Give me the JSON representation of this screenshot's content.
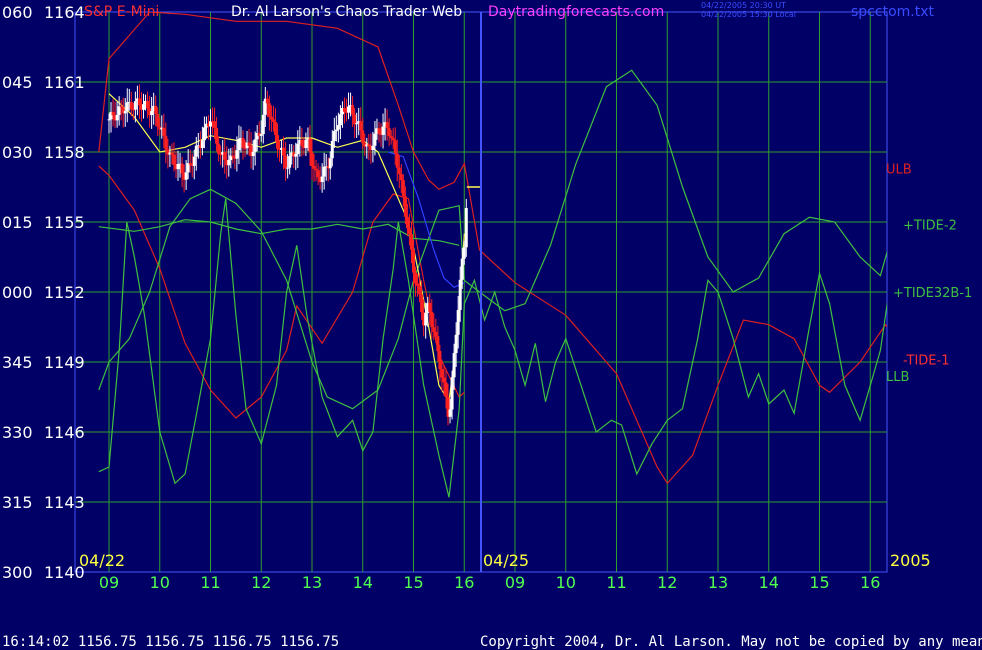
{
  "header": {
    "instrument": "S&P E-Mini",
    "title": "Dr. Al Larson's Chaos Trader Web",
    "site": "Daytradingforecasts.com",
    "time_ut": "04/22/2005 20:30 UT",
    "time_local": "04/22/2005 15:30 Local",
    "file": "spcctom.txt"
  },
  "footer": {
    "quote": "16:14:02  1156.75 1156.75 1156.75 1156.75",
    "copyright": "Copyright 2004, Dr. Al Larson. May not be copied by any means."
  },
  "colors": {
    "background": "#000066",
    "grid": "#2ea02e",
    "panel_outer": "#ffffff",
    "text_left": "#ffffff",
    "header_red": "#ff3030",
    "header_white": "#ffffff",
    "header_magenta": "#ff40ff",
    "header_blue": "#3a4cff",
    "tick_green": "#50ff50",
    "tick_yellow": "#ffff40",
    "footer_text": "#ffffff",
    "ulb": "#dd2020",
    "llb": "#dd2020",
    "tide2": "#40c040",
    "tide32": "#40c040",
    "tide1": "#40c040",
    "blue_line": "#3040ff",
    "yellow_line": "#ffff50",
    "candle_white": "#ffffff",
    "candle_red": "#ff2020"
  },
  "chart_data": {
    "type": "line",
    "title": "Dr. Al Larson's Chaos Trader Web",
    "ylim": [
      1140,
      1164
    ],
    "grid": true,
    "y_ticks_price": [
      1164,
      1161,
      1158,
      1155,
      1152,
      1149,
      1146,
      1143,
      1140
    ],
    "y_ticks_angle": [
      "060",
      "045",
      "030",
      "015",
      "000",
      "345",
      "330",
      "315",
      "300"
    ],
    "x_ticks": [
      "09",
      "10",
      "11",
      "12",
      "13",
      "14",
      "15",
      "16",
      "09",
      "10",
      "11",
      "12",
      "13",
      "14",
      "15",
      "16"
    ],
    "date_labels": [
      "04/22",
      "04/25"
    ],
    "year_label": "2005",
    "series_labels": [
      {
        "name": "ULB",
        "y": 1157.3
      },
      {
        "name": "+TIDE-2",
        "y": 1154.9
      },
      {
        "name": "+TIDE32B-1",
        "y": 1152.0
      },
      {
        "name": "-TIDE-1",
        "y": 1149.1
      },
      {
        "name": "LLB",
        "y": 1148.4
      }
    ],
    "series": [
      {
        "name": "ULB",
        "color_key": "ulb",
        "points": [
          [
            -0.2,
            1158
          ],
          [
            0,
            1162
          ],
          [
            0.8,
            1164
          ],
          [
            1.5,
            1163.9
          ],
          [
            2.5,
            1163.6
          ],
          [
            3.5,
            1163.6
          ],
          [
            4.5,
            1163.3
          ],
          [
            5.3,
            1162.5
          ],
          [
            5.7,
            1160.0
          ],
          [
            6.0,
            1158.0
          ],
          [
            6.3,
            1156.8
          ],
          [
            6.5,
            1156.4
          ],
          [
            6.8,
            1156.7
          ],
          [
            7.0,
            1157.5
          ],
          [
            7.3,
            1153.8
          ],
          [
            8.0,
            1152.4
          ],
          [
            9.0,
            1151.0
          ],
          [
            10.0,
            1148.5
          ],
          [
            10.8,
            1144.5
          ],
          [
            11.0,
            1143.8
          ],
          [
            11.5,
            1145.0
          ],
          [
            12.0,
            1148.0
          ],
          [
            12.5,
            1150.8
          ],
          [
            13.0,
            1150.6
          ],
          [
            13.5,
            1150.0
          ],
          [
            14.0,
            1148.0
          ],
          [
            14.2,
            1147.7
          ],
          [
            14.8,
            1149.0
          ],
          [
            15.3,
            1150.6
          ],
          [
            15.5,
            1150.0
          ]
        ]
      },
      {
        "name": "LLB",
        "color_key": "llb",
        "points": [
          [
            -0.2,
            1157.4
          ],
          [
            0,
            1157.0
          ],
          [
            0.5,
            1155.5
          ],
          [
            1.0,
            1153.0
          ],
          [
            1.5,
            1149.8
          ],
          [
            2.0,
            1147.8
          ],
          [
            2.5,
            1146.6
          ],
          [
            3.0,
            1147.5
          ],
          [
            3.5,
            1149.5
          ],
          [
            3.7,
            1151.4
          ],
          [
            4.2,
            1149.8
          ],
          [
            4.8,
            1152.0
          ],
          [
            5.2,
            1155.0
          ],
          [
            5.6,
            1156.2
          ],
          [
            5.9,
            1156.0
          ],
          [
            6.2,
            1152.5
          ],
          [
            6.5,
            1149.3
          ],
          [
            6.9,
            1147.5
          ],
          [
            7.0,
            1147.7
          ]
        ]
      },
      {
        "name": "+TIDE-2",
        "color_key": "tide2",
        "points": [
          [
            -0.2,
            1147.8
          ],
          [
            0,
            1149.0
          ],
          [
            0.4,
            1150.0
          ],
          [
            0.8,
            1152.0
          ],
          [
            1.2,
            1154.8
          ],
          [
            1.6,
            1156.0
          ],
          [
            2.0,
            1156.4
          ],
          [
            2.5,
            1155.8
          ],
          [
            3.0,
            1154.6
          ],
          [
            3.5,
            1152.5
          ],
          [
            4.0,
            1149.0
          ],
          [
            4.3,
            1147.5
          ],
          [
            4.8,
            1147.0
          ],
          [
            5.3,
            1147.8
          ],
          [
            5.7,
            1150.0
          ],
          [
            6.0,
            1152.5
          ],
          [
            6.5,
            1155.5
          ],
          [
            6.9,
            1155.7
          ],
          [
            7.0,
            1152.5
          ],
          [
            7.3,
            1152.0
          ],
          [
            7.8,
            1151.2
          ],
          [
            8.2,
            1151.5
          ],
          [
            8.7,
            1154.0
          ],
          [
            9.2,
            1157.5
          ],
          [
            9.8,
            1160.8
          ],
          [
            10.3,
            1161.5
          ],
          [
            10.8,
            1160.0
          ],
          [
            11.3,
            1156.5
          ],
          [
            11.8,
            1153.5
          ],
          [
            12.3,
            1152.0
          ],
          [
            12.8,
            1152.6
          ],
          [
            13.3,
            1154.5
          ],
          [
            13.8,
            1155.2
          ],
          [
            14.3,
            1155.0
          ],
          [
            14.8,
            1153.5
          ],
          [
            15.2,
            1152.7
          ],
          [
            15.5,
            1155.0
          ]
        ]
      },
      {
        "name": "+TIDE32B-1",
        "color_key": "tide32",
        "points": [
          [
            -0.2,
            1154.8
          ],
          [
            0.5,
            1154.6
          ],
          [
            1.0,
            1154.8
          ],
          [
            1.5,
            1155.1
          ],
          [
            2.0,
            1155.0
          ],
          [
            2.5,
            1154.7
          ],
          [
            3.0,
            1154.5
          ],
          [
            3.5,
            1154.7
          ],
          [
            4.0,
            1154.7
          ],
          [
            4.5,
            1154.9
          ],
          [
            5.0,
            1154.7
          ],
          [
            5.5,
            1154.9
          ],
          [
            6.0,
            1154.3
          ],
          [
            6.5,
            1154.2
          ],
          [
            6.9,
            1154.0
          ]
        ]
      },
      {
        "name": "-TIDE-1",
        "color_key": "tide1",
        "points": [
          [
            -0.2,
            1144.3
          ],
          [
            0,
            1144.5
          ],
          [
            0.2,
            1149.5
          ],
          [
            0.35,
            1155.0
          ],
          [
            0.5,
            1153.5
          ],
          [
            0.7,
            1151.0
          ],
          [
            1.0,
            1146.0
          ],
          [
            1.3,
            1143.8
          ],
          [
            1.5,
            1144.2
          ],
          [
            1.7,
            1146.5
          ],
          [
            2.0,
            1150.0
          ],
          [
            2.2,
            1154.5
          ],
          [
            2.3,
            1156.0
          ],
          [
            2.5,
            1151.0
          ],
          [
            2.7,
            1147.0
          ],
          [
            3.0,
            1145.5
          ],
          [
            3.3,
            1148.0
          ],
          [
            3.5,
            1152.0
          ],
          [
            3.7,
            1154.0
          ],
          [
            3.9,
            1151.0
          ],
          [
            4.2,
            1147.5
          ],
          [
            4.5,
            1145.8
          ],
          [
            4.8,
            1146.5
          ],
          [
            5.0,
            1145.2
          ],
          [
            5.2,
            1146.0
          ],
          [
            5.4,
            1150.0
          ],
          [
            5.6,
            1153.0
          ],
          [
            5.7,
            1155.0
          ],
          [
            5.9,
            1152.5
          ],
          [
            6.2,
            1148.0
          ],
          [
            6.5,
            1145.0
          ],
          [
            6.7,
            1143.2
          ],
          [
            6.9,
            1147.0
          ],
          [
            7.0,
            1151.5
          ],
          [
            7.2,
            1152.5
          ],
          [
            7.4,
            1150.8
          ],
          [
            7.6,
            1152.0
          ],
          [
            7.8,
            1150.5
          ],
          [
            8.0,
            1149.5
          ],
          [
            8.2,
            1148.0
          ],
          [
            8.4,
            1149.8
          ],
          [
            8.6,
            1147.3
          ],
          [
            8.8,
            1149.0
          ],
          [
            9.0,
            1150.0
          ],
          [
            9.3,
            1148.0
          ],
          [
            9.6,
            1146.0
          ],
          [
            9.9,
            1146.5
          ],
          [
            10.1,
            1146.3
          ],
          [
            10.4,
            1144.2
          ],
          [
            10.7,
            1145.5
          ],
          [
            11.0,
            1146.5
          ],
          [
            11.3,
            1147.0
          ],
          [
            11.6,
            1150.0
          ],
          [
            11.8,
            1152.5
          ],
          [
            12.0,
            1152.0
          ],
          [
            12.3,
            1150.0
          ],
          [
            12.6,
            1147.5
          ],
          [
            12.8,
            1148.5
          ],
          [
            13.0,
            1147.2
          ],
          [
            13.3,
            1147.8
          ],
          [
            13.5,
            1146.8
          ],
          [
            13.8,
            1150.5
          ],
          [
            14.0,
            1152.8
          ],
          [
            14.2,
            1151.5
          ],
          [
            14.5,
            1148.0
          ],
          [
            14.8,
            1146.5
          ],
          [
            15.0,
            1148.0
          ],
          [
            15.2,
            1149.5
          ],
          [
            15.4,
            1152.5
          ],
          [
            15.5,
            1151.8
          ]
        ]
      },
      {
        "name": "blue",
        "color_key": "blue_line",
        "points": [
          [
            5.5,
            1158.0
          ],
          [
            5.8,
            1157.8
          ],
          [
            6.1,
            1156.0
          ],
          [
            6.4,
            1153.8
          ],
          [
            6.6,
            1152.6
          ],
          [
            6.8,
            1152.2
          ],
          [
            7.0,
            1152.4
          ]
        ]
      },
      {
        "name": "yellow",
        "color_key": "yellow_line",
        "points": [
          [
            0,
            1160.5
          ],
          [
            0.5,
            1159.5
          ],
          [
            1.0,
            1158.0
          ],
          [
            1.5,
            1158.2
          ],
          [
            2.0,
            1158.7
          ],
          [
            2.5,
            1158.5
          ],
          [
            3.0,
            1158.2
          ],
          [
            3.5,
            1158.6
          ],
          [
            4.0,
            1158.6
          ],
          [
            4.5,
            1158.2
          ],
          [
            5.0,
            1158.5
          ],
          [
            5.3,
            1158.0
          ],
          [
            5.6,
            1156.5
          ],
          [
            5.9,
            1155.0
          ],
          [
            6.1,
            1152.8
          ],
          [
            6.3,
            1150.5
          ],
          [
            6.5,
            1148.0
          ],
          [
            6.7,
            1147.3
          ],
          [
            6.9,
            1150.8
          ],
          [
            7.0,
            1154.5
          ]
        ]
      }
    ],
    "price_path": [
      [
        0,
        1159.4
      ],
      [
        0.3,
        1159.9
      ],
      [
        0.6,
        1160.1
      ],
      [
        0.9,
        1159.7
      ],
      [
        1.2,
        1157.8
      ],
      [
        1.5,
        1157.0
      ],
      [
        1.8,
        1158.4
      ],
      [
        2.0,
        1159.5
      ],
      [
        2.2,
        1157.8
      ],
      [
        2.4,
        1157.6
      ],
      [
        2.6,
        1158.5
      ],
      [
        2.8,
        1158.0
      ],
      [
        3.0,
        1159.0
      ],
      [
        3.1,
        1160.3
      ],
      [
        3.3,
        1158.5
      ],
      [
        3.5,
        1157.4
      ],
      [
        3.7,
        1158.2
      ],
      [
        3.9,
        1158.5
      ],
      [
        4.1,
        1156.8
      ],
      [
        4.3,
        1157.3
      ],
      [
        4.5,
        1159.3
      ],
      [
        4.7,
        1160.0
      ],
      [
        4.9,
        1159.2
      ],
      [
        5.1,
        1158.0
      ],
      [
        5.3,
        1158.9
      ],
      [
        5.5,
        1159.1
      ],
      [
        5.7,
        1157.4
      ],
      [
        5.9,
        1154.6
      ],
      [
        6.0,
        1153.0
      ],
      [
        6.2,
        1150.8
      ],
      [
        6.3,
        1151.4
      ],
      [
        6.5,
        1149.2
      ],
      [
        6.7,
        1146.6
      ],
      [
        6.8,
        1149.2
      ],
      [
        6.9,
        1152.0
      ],
      [
        7.0,
        1154.0
      ],
      [
        7.05,
        1156.3
      ]
    ],
    "last_price_marker": 1156.5
  }
}
